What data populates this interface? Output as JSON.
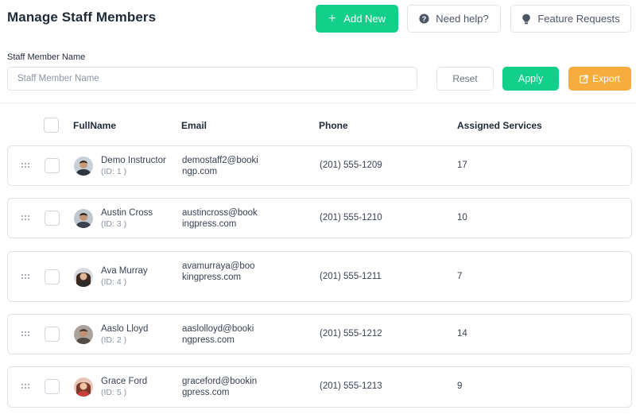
{
  "page": {
    "title": "Manage Staff Members"
  },
  "toolbar": {
    "add_label": "Add New",
    "help_label": "Need help?",
    "feature_label": "Feature Requests"
  },
  "filter": {
    "label": "Staff Member Name",
    "placeholder": "Staff Member Name",
    "value": "",
    "reset_label": "Reset",
    "apply_label": "Apply",
    "export_label": "Export"
  },
  "colors": {
    "primary": "#12d08a",
    "export": "#f6ad3d",
    "border": "#dfe3e8"
  },
  "table": {
    "columns": [
      "FullName",
      "Email",
      "Phone",
      "Assigned Services"
    ],
    "rows": [
      {
        "name": "Demo Instructor",
        "id": "(ID: 1 )",
        "email": "demostaff2@bookingp.com",
        "phone": "(201) 555-1209",
        "services": "17"
      },
      {
        "name": "Austin Cross",
        "id": "(ID: 3 )",
        "email": "austincross@bookingpress.com",
        "phone": "(201) 555-1210",
        "services": "10"
      },
      {
        "name": "Ava Murray",
        "id": "(ID: 4 )",
        "email": "avamurraya@bookingpress.com",
        "phone": "(201) 555-1211",
        "services": "7"
      },
      {
        "name": "Aaslo Lloyd",
        "id": "(ID: 2 )",
        "email": "aaslolloyd@bookingpress.com",
        "phone": "(201) 555-1212",
        "services": "14"
      },
      {
        "name": "Grace Ford",
        "id": "(ID: 5 )",
        "email": "graceford@bookingpress.com",
        "phone": "(201) 555-1213",
        "services": "9"
      }
    ]
  }
}
